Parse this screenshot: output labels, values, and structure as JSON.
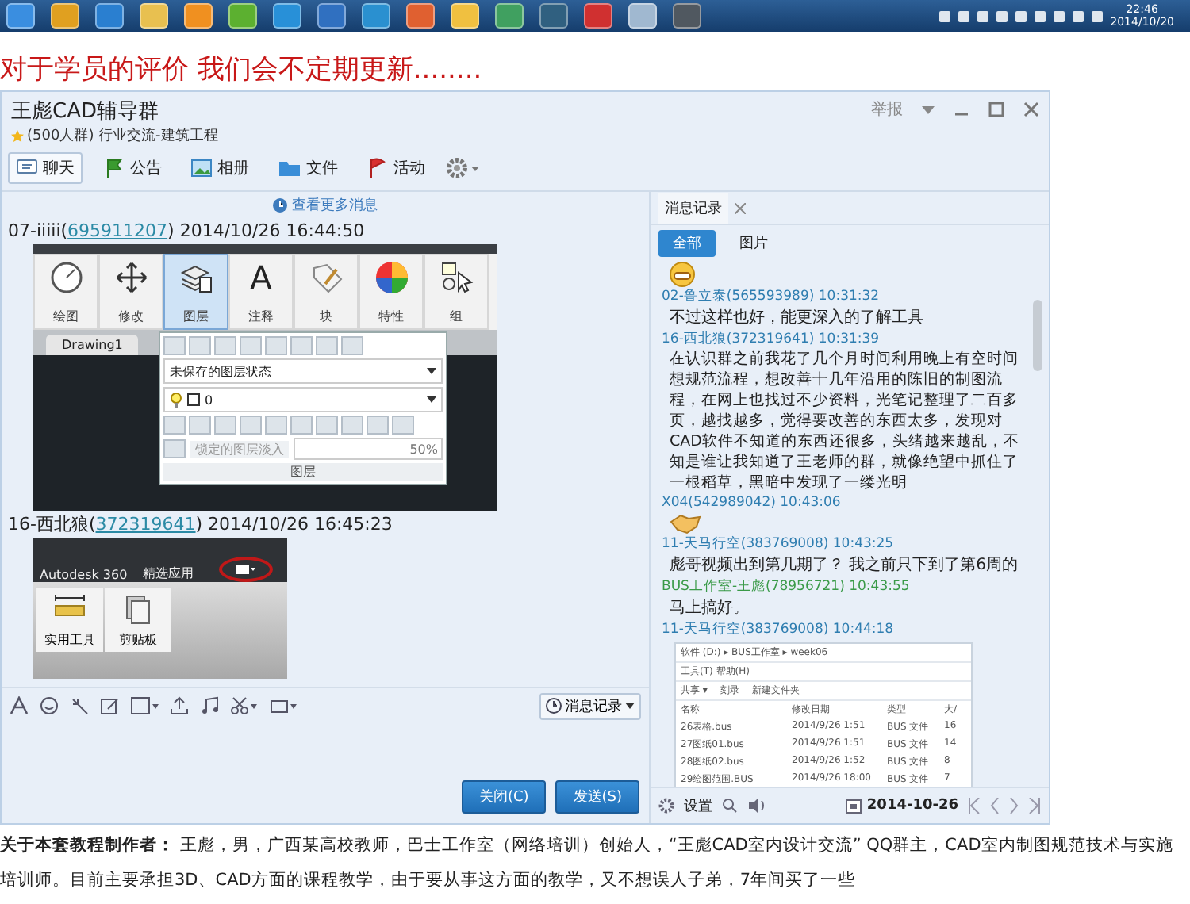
{
  "taskbar": {
    "apps": [
      {
        "color": "#3a8ee0"
      },
      {
        "color": "#e0a020"
      },
      {
        "color": "#2a7fd0"
      },
      {
        "color": "#e8c050"
      },
      {
        "color": "#f09020"
      },
      {
        "color": "#5cb030"
      },
      {
        "color": "#2890d8"
      },
      {
        "color": "#3070c0"
      },
      {
        "color": "#2a90d0"
      },
      {
        "color": "#e06030"
      },
      {
        "color": "#f0c040"
      },
      {
        "color": "#40a060"
      },
      {
        "color": "#306080"
      },
      {
        "color": "#d03030"
      },
      {
        "color": "#a0b8d0"
      },
      {
        "color": "#505860"
      }
    ],
    "clock_time": "22:46",
    "clock_date": "2014/10/20"
  },
  "heading": "对于学员的评价 我们会不定期更新........",
  "chat_window": {
    "title": "王彪CAD辅导群",
    "subtitle": "(500人群) 行业交流-建筑工程",
    "report": "举报",
    "tabs": [
      {
        "label": "聊天",
        "selected": true
      },
      {
        "label": "公告",
        "selected": false
      },
      {
        "label": "相册",
        "selected": false
      },
      {
        "label": "文件",
        "selected": false
      },
      {
        "label": "活动",
        "selected": false
      }
    ],
    "more_messages": "查看更多消息",
    "messages": [
      {
        "kind": "ribbon-shot",
        "sender": "07-iiiii(",
        "qq": "695911207",
        "time": ") 2014/10/26 16:44:50",
        "ribbon": [
          {
            "label": "绘图",
            "selected": false
          },
          {
            "label": "修改",
            "selected": false
          },
          {
            "label": "图层",
            "selected": true
          },
          {
            "label": "注释",
            "glyph": "A",
            "selected": false
          },
          {
            "label": "块",
            "selected": false
          },
          {
            "label": "特性",
            "selected": false
          },
          {
            "label": "组",
            "selected": false
          }
        ],
        "drawing_tab": "Drawing1",
        "layer_state": "未保存的图层状态",
        "layer_name": "0",
        "fade_label": "锁定的图层淡入",
        "fade_value": "50%",
        "panel_title": "图层"
      },
      {
        "kind": "menu-shot",
        "sender": "16-西北狼(",
        "qq": "372319641",
        "time": ") 2014/10/26 16:45:23",
        "menu": [
          "Autodesk 360",
          "精选应用"
        ],
        "tools": [
          {
            "label": "实用工具"
          },
          {
            "label": "剪贴板"
          }
        ]
      }
    ],
    "history_button": "消息记录",
    "buttons": [
      "关闭(C)",
      "发送(S)"
    ],
    "history": {
      "title": "消息记录",
      "filters": [
        {
          "label": "全部",
          "selected": true
        },
        {
          "label": "图片",
          "selected": false
        }
      ],
      "records": [
        {
          "kind": "grin"
        },
        {
          "kind": "text",
          "sender": "02-鲁立泰(565593989) 10:31:32",
          "color": "#2e7db0",
          "text": "不过这样也好，能更深入的了解工具"
        },
        {
          "kind": "text",
          "sender": "16-西北狼(372319641) 10:31:39",
          "color": "#2e7db0",
          "text": "在认识群之前我花了几个月时间利用晚上有空时间想规范流程，想改善十几年沿用的陈旧的制图流程，在网上也找过不少资料，光笔记整理了二百多页，越找越多，觉得要改善的东西太多，发现对CAD软件不知道的东西还很多，头绪越来越乱，不知是谁让我知道了王老师的群，就像绝望中抓住了一根稻草，黑暗中发现了一缕光明"
        },
        {
          "kind": "handshake",
          "sender": "X04(542989042) 10:43:06",
          "color": "#2e7db0"
        },
        {
          "kind": "text",
          "sender": "11-天马行空(383769008) 10:43:25",
          "color": "#2e7db0",
          "text": "彪哥视频出到第几期了？ 我之前只下到了第6周的"
        },
        {
          "kind": "text",
          "sender": "BUS工作室-王彪(78956721) 10:43:55",
          "color": "#3a9a48",
          "text": "马上搞好。"
        },
        {
          "kind": "explorer",
          "sender": "11-天马行空(383769008) 10:44:18",
          "color": "#2e7db0",
          "path": "软件 (D:) ▸ BUS工作室 ▸ week06",
          "menu": "工具(T)  帮助(H)",
          "toolbar": [
            "共享 ▾",
            "刻录",
            "新建文件夹"
          ],
          "columns": [
            "名称",
            "修改日期",
            "类型",
            "大/"
          ],
          "rows": [
            [
              "26表格.bus",
              "2014/9/26 1:51",
              "BUS 文件",
              "16"
            ],
            [
              "27图纸01.bus",
              "2014/9/26 1:51",
              "BUS 文件",
              "14"
            ],
            [
              "28图纸02.bus",
              "2014/9/26 1:52",
              "BUS 文件",
              "8"
            ],
            [
              "29绘图范围.BUS",
              "2014/9/26 18:00",
              "BUS 文件",
              "7"
            ]
          ]
        }
      ],
      "settings": "设置",
      "date": "2014-10-26"
    }
  },
  "footer_text": "**关于本套教程制作者：** 王彪，男，广西某高校教师，巴士工作室（网络培训）创始人，“王彪CAD室内设计交流” QQ群主，CAD室内制图规范技术与实施培训师。目前主要承担3D、CAD方面的课程教学，由于要从事这方面的教学，又不想误人子弟，7年间买了一些"
}
